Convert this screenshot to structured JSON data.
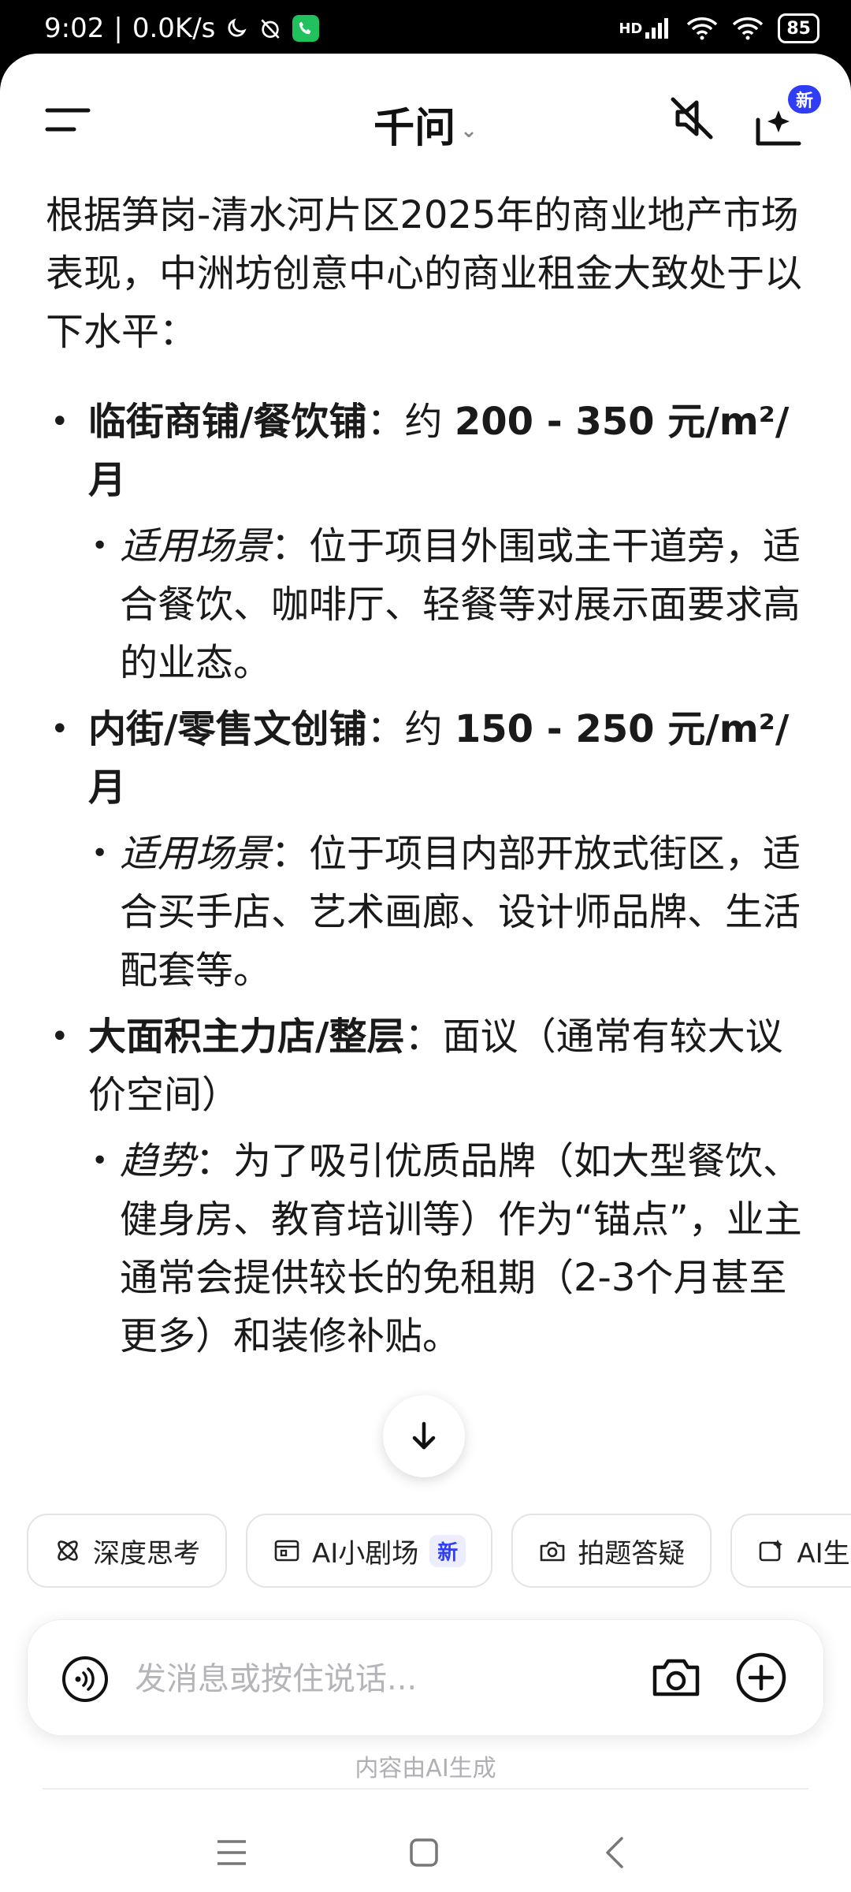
{
  "status_bar": {
    "time": "9:02",
    "net_speed": "0.0K/s",
    "signal_label": "HD",
    "battery": "85"
  },
  "header": {
    "title": "千问",
    "new_badge": "新"
  },
  "content": {
    "intro": "根据笋岗-清水河片区2025年的商业地产市场表现，中洲坊创意中心的商业租金大致处于以下水平：",
    "items": [
      {
        "label": "临街商铺/餐饮铺",
        "sep": "：约 ",
        "value": "200 - 350 元/m²/月",
        "sub_label": "适用场景",
        "sub_text": "：位于项目外围或主干道旁，适合餐饮、咖啡厅、轻餐等对展示面要求高的业态。"
      },
      {
        "label": "内街/零售文创铺",
        "sep": "：约 ",
        "value": "150 - 250 元/m²/月",
        "sub_label": "适用场景",
        "sub_text": "：位于项目内部开放式街区，适合买手店、艺术画廊、设计师品牌、生活配套等。"
      },
      {
        "label": "大面积主力店/整层",
        "sep": "：",
        "value": "面议（通常有较大议价空间）",
        "sub_label": "趋势",
        "sub_text": "：为了吸引优质品牌（如大型餐饮、健身房、教育培训等）作为“锚点”，业主通常会提供较长的免租期（2-3个月甚至更多）和装修补贴。"
      }
    ]
  },
  "chips": [
    {
      "label": "深度思考",
      "icon": "atom-icon",
      "badge": ""
    },
    {
      "label": "AI小剧场",
      "icon": "theater-icon",
      "badge": "新"
    },
    {
      "label": "拍题答疑",
      "icon": "photo-question-icon",
      "badge": ""
    },
    {
      "label": "AI生",
      "icon": "ai-create-icon",
      "badge": ""
    }
  ],
  "input": {
    "placeholder": "发消息或按住说话..."
  },
  "footer": {
    "disclaimer": "内容由AI生成"
  },
  "colors": {
    "accent": "#2f3df6",
    "status_bar_bg": "#000000",
    "surface": "#ffffff"
  }
}
